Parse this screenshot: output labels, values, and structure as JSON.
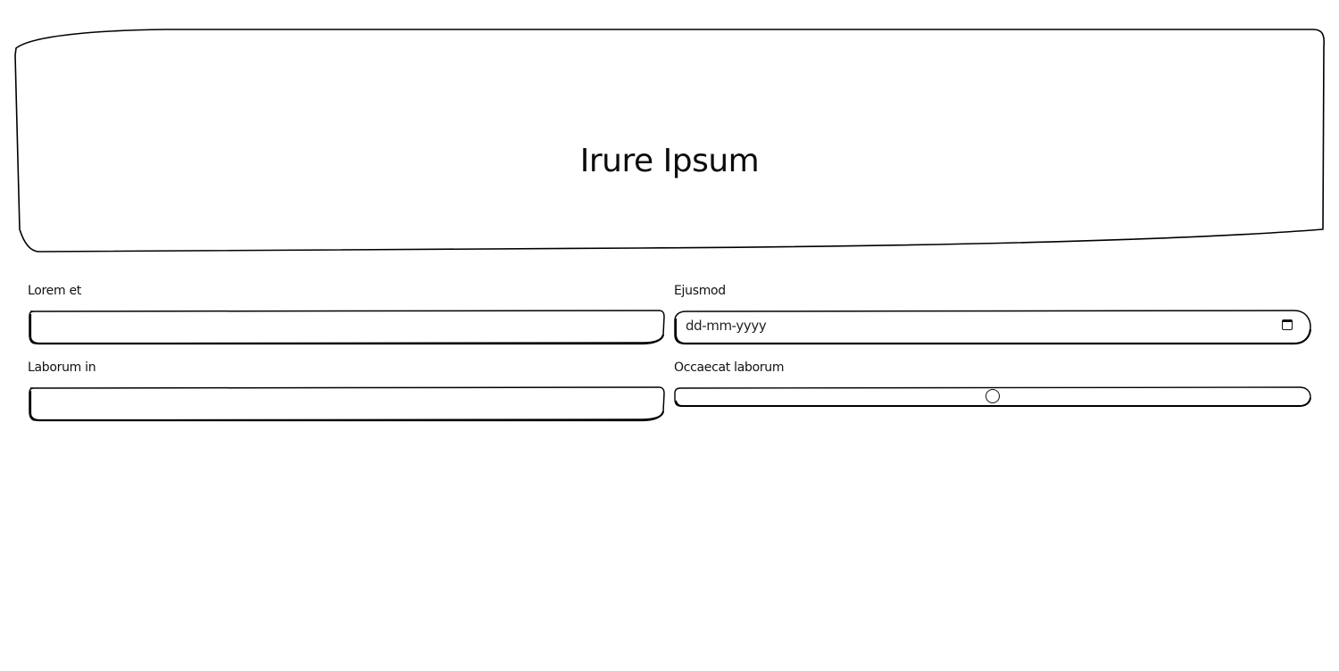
{
  "header": {
    "title": "Irure Ipsum"
  },
  "form": {
    "field1": {
      "label": "Lorem et",
      "value": ""
    },
    "field2": {
      "label": "Ejusmod",
      "placeholder": "dd-mm-yyyy",
      "icon": "calendar-icon"
    },
    "field3": {
      "label": "Laborum in",
      "value": ""
    },
    "field4": {
      "label": "Occaecat laborum",
      "slider_fraction": 0.5
    }
  },
  "colors": {
    "stroke": "#000000",
    "background": "#ffffff"
  }
}
